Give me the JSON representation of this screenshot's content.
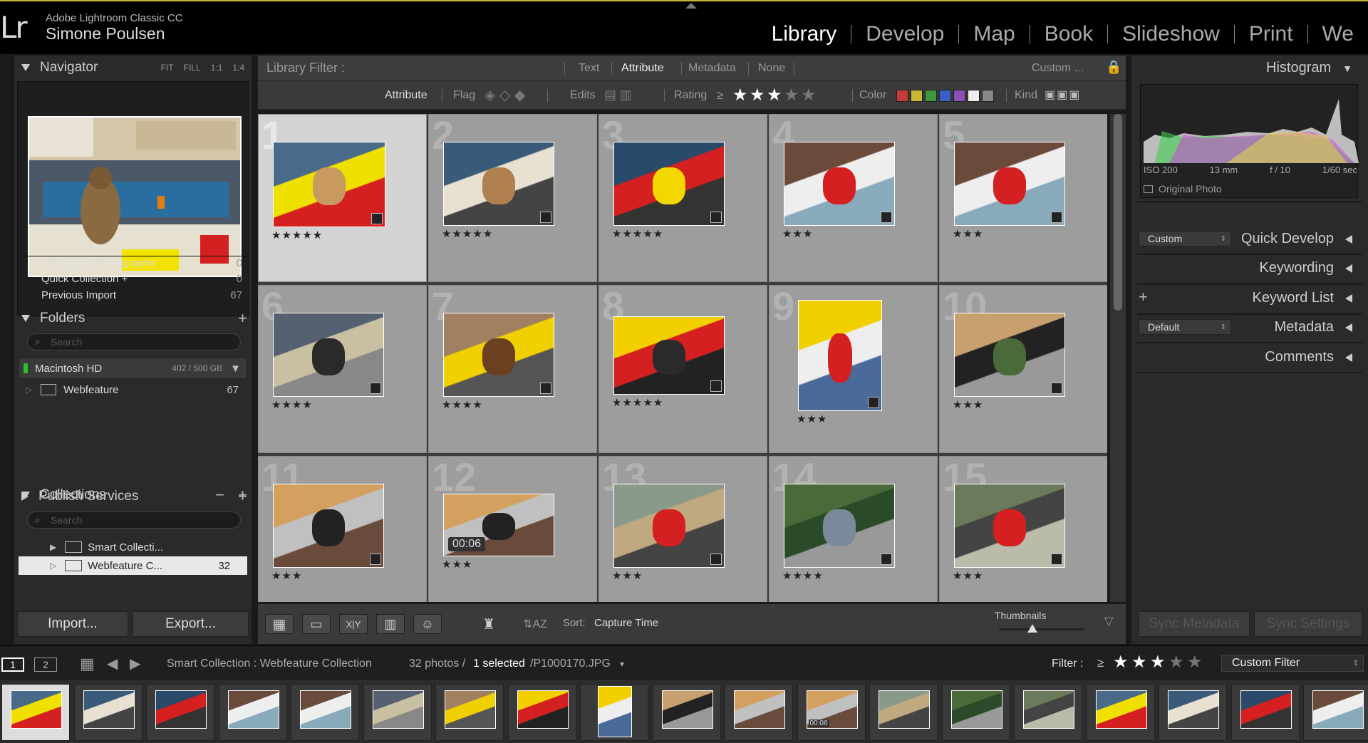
{
  "header": {
    "app_name": "Adobe Lightroom Classic CC",
    "user": "Simone Poulsen",
    "logo": "Lr",
    "modules": [
      "Library",
      "Develop",
      "Map",
      "Book",
      "Slideshow",
      "Print",
      "We"
    ]
  },
  "left_panel": {
    "navigator": {
      "title": "Navigator",
      "zoom": [
        "FIT",
        "FILL",
        "1:1",
        "1:4"
      ]
    },
    "catalog_rows": [
      {
        "label": "All Synced Photographs",
        "count": "0"
      },
      {
        "label": "Quick Collection +",
        "count": "0"
      },
      {
        "label": "Previous Import",
        "count": "67"
      }
    ],
    "folders": {
      "title": "Folders",
      "search_placeholder": "Search",
      "volume": {
        "label": "Macintosh HD",
        "size": "402 / 500 GB"
      },
      "items": [
        {
          "label": "Webfeature",
          "count": "67"
        }
      ]
    },
    "collections": {
      "title": "Collections",
      "search_placeholder": "Search",
      "items": [
        {
          "label": "Smart Collecti...",
          "count": ""
        },
        {
          "label": "Webfeature C...",
          "count": "32"
        }
      ]
    },
    "publish_services": {
      "title": "Publish Services"
    },
    "import_label": "Import...",
    "export_label": "Export..."
  },
  "library_filter": {
    "title": "Library Filter :",
    "tabs": [
      "Text",
      "Attribute",
      "Metadata",
      "None"
    ],
    "active_tab": "Attribute",
    "preset": "Custom ...",
    "attribute_label": "Attribute",
    "flag_label": "Flag",
    "edits_label": "Edits",
    "rating_label": "Rating",
    "rating_op": "≥",
    "rating_value": 3,
    "color_label": "Color",
    "kind_label": "Kind",
    "colors": [
      "#c63a3a",
      "#c8b834",
      "#3c9a3c",
      "#3a5fc4",
      "#8a4fb8",
      "#eeeeee",
      "#888888"
    ]
  },
  "grid": {
    "cells": [
      {
        "num": "1",
        "stars": "★★★★★",
        "selected": true
      },
      {
        "num": "2",
        "stars": "★★★★★"
      },
      {
        "num": "3",
        "stars": "★★★★★"
      },
      {
        "num": "4",
        "stars": "★★★"
      },
      {
        "num": "5",
        "stars": "★★★"
      },
      {
        "num": "6",
        "stars": "★★★★"
      },
      {
        "num": "7",
        "stars": "★★★★"
      },
      {
        "num": "8",
        "stars": "★★★★★"
      },
      {
        "num": "9",
        "stars": "★★★"
      },
      {
        "num": "10",
        "stars": "★★★"
      },
      {
        "num": "11",
        "stars": "★★★"
      },
      {
        "num": "12",
        "stars": "★★★",
        "duration": "00:06"
      },
      {
        "num": "13",
        "stars": "★★★"
      },
      {
        "num": "14",
        "stars": "★★★★"
      },
      {
        "num": "15",
        "stars": "★★★"
      }
    ]
  },
  "toolbar": {
    "sort_label": "Sort:",
    "sort_value": "Capture Time",
    "thumbnails_label": "Thumbnails"
  },
  "right_panel": {
    "histogram": {
      "title": "Histogram",
      "iso": "ISO 200",
      "focal": "13 mm",
      "aperture": "f / 10",
      "shutter": "1/60 sec",
      "original_photo": "Original Photo"
    },
    "quick_develop": {
      "title": "Quick Develop",
      "preset": "Custom"
    },
    "keywording": "Keywording",
    "keyword_list": "Keyword List",
    "metadata": {
      "title": "Metadata",
      "preset": "Default"
    },
    "comments": "Comments",
    "sync_metadata": "Sync Metadata",
    "sync_settings": "Sync Settings"
  },
  "filmstrip_bar": {
    "screen1": "1",
    "screen2": "2",
    "source": "Smart Collection : Webfeature Collection",
    "count": "32 photos /",
    "selected": "1 selected",
    "file": "/P1000170.JPG",
    "filter_label": "Filter :",
    "filter_op": "≥",
    "filter_value": "Custom Filter"
  },
  "filmstrip": {
    "count": 19,
    "duration": "00:06"
  }
}
